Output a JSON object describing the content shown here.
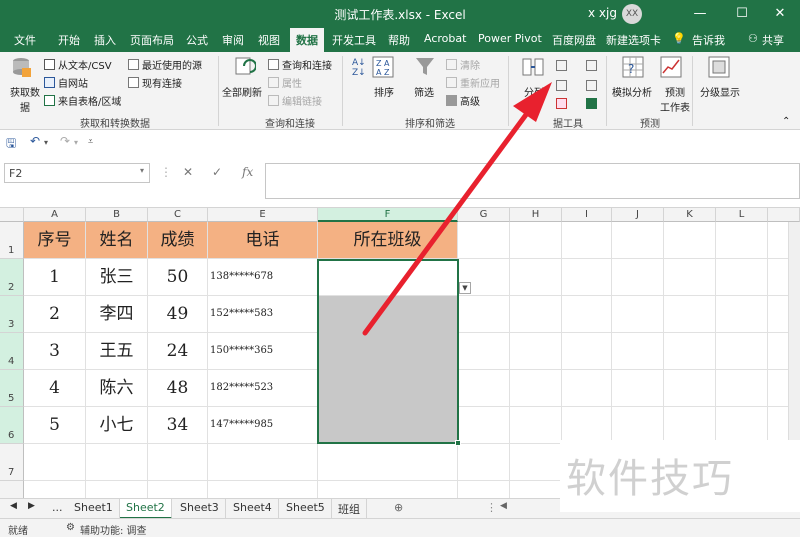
{
  "window": {
    "title": "测试工作表.xlsx  -  Excel",
    "user": "x xjg",
    "avatar": "XX",
    "btn_min": "—",
    "btn_max": "☐",
    "btn_close": "✕"
  },
  "tabs": {
    "file": "文件",
    "home": "开始",
    "insert": "插入",
    "layout": "页面布局",
    "formulas": "公式",
    "review": "审阅",
    "view": "视图",
    "data": "数据",
    "dev": "开发工具",
    "help": "帮助",
    "acrobat": "Acrobat",
    "powerpivot": "Power Pivot",
    "baidu": "百度网盘",
    "newtab": "新建选项卡",
    "tellme": "告诉我",
    "share": "共享"
  },
  "ribbon": {
    "get_data": "获取数据",
    "from_text": "从文本/CSV",
    "from_web": "自网站",
    "from_table": "来自表格/区域",
    "recent_sources": "最近使用的源",
    "existing_conn": "现有连接",
    "group_get": "获取和转换数据",
    "refresh_all": "全部刷新",
    "queries_conn": "查询和连接",
    "properties": "属性",
    "edit_links": "编辑链接",
    "group_queries": "查询和连接",
    "sort": "排序",
    "filter": "筛选",
    "clear": "清除",
    "reapply": "重新应用",
    "advanced": "高级",
    "group_sort": "排序和筛选",
    "text_to_cols": "分列",
    "group_tools": "据工具",
    "whatif": "模拟分析",
    "forecast_sheet": "预测",
    "forecast_sheet2": "工作表",
    "group_forecast": "预测",
    "outline": "分级显示"
  },
  "formula_bar": {
    "name_box": "F2",
    "fx": "fx",
    "cancel": "✕",
    "enter": "✓"
  },
  "columns": [
    "A",
    "B",
    "C",
    "E",
    "F",
    "G",
    "H",
    "I",
    "J",
    "K",
    "L"
  ],
  "rows": [
    "1",
    "2",
    "3",
    "4",
    "5",
    "6",
    "7"
  ],
  "table": {
    "headers": [
      "序号",
      "姓名",
      "成绩",
      "电话",
      "所在班级"
    ],
    "rows": [
      [
        "1",
        "张三",
        "50",
        "138*****678",
        ""
      ],
      [
        "2",
        "李四",
        "49",
        "152*****583",
        ""
      ],
      [
        "3",
        "王五",
        "24",
        "150*****365",
        ""
      ],
      [
        "4",
        "陈六",
        "48",
        "182*****523",
        ""
      ],
      [
        "5",
        "小七",
        "34",
        "147*****985",
        ""
      ]
    ]
  },
  "sheets": [
    "Sheet1",
    "Sheet2",
    "Sheet3",
    "Sheet4",
    "Sheet5",
    "班组"
  ],
  "active_sheet": "Sheet2",
  "status": {
    "mode": "就绪",
    "accessibility": "辅助功能: 调查"
  },
  "watermark": "软件技巧",
  "colors": {
    "excel_green": "#217346",
    "header_fill": "#f4b183",
    "selection_fill": "#c8c8c8",
    "arrow": "#e8212e"
  }
}
